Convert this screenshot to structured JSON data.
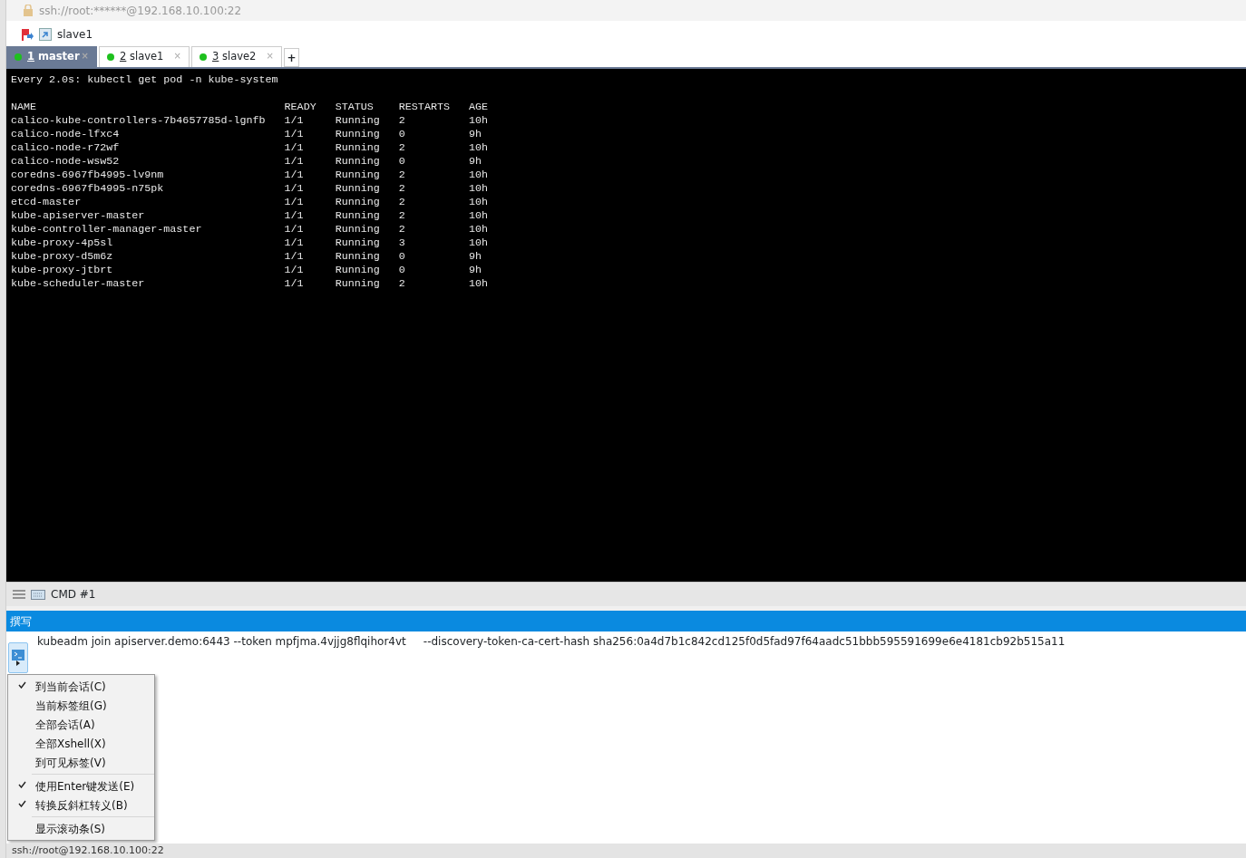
{
  "address_bar": {
    "text": "ssh://root:******@192.168.10.100:22"
  },
  "session_bar": {
    "title": "slave1"
  },
  "tabs": [
    {
      "number": "1",
      "name": "master",
      "selected": true,
      "connected": true,
      "close": "×"
    },
    {
      "number": "2",
      "name": "slave1",
      "selected": false,
      "connected": true,
      "close": "×"
    },
    {
      "number": "3",
      "name": "slave2",
      "selected": false,
      "connected": true,
      "close": "×"
    }
  ],
  "new_tab": "+",
  "terminal": {
    "header": "Every 2.0s: kubectl get pod -n kube-system",
    "columns": [
      "NAME",
      "READY",
      "STATUS",
      "RESTARTS",
      "AGE"
    ],
    "rows": [
      [
        "calico-kube-controllers-7b4657785d-lgnfb",
        "1/1",
        "Running",
        "2",
        "10h"
      ],
      [
        "calico-node-lfxc4",
        "1/1",
        "Running",
        "0",
        "9h"
      ],
      [
        "calico-node-r72wf",
        "1/1",
        "Running",
        "2",
        "10h"
      ],
      [
        "calico-node-wsw52",
        "1/1",
        "Running",
        "0",
        "9h"
      ],
      [
        "coredns-6967fb4995-lv9nm",
        "1/1",
        "Running",
        "2",
        "10h"
      ],
      [
        "coredns-6967fb4995-n75pk",
        "1/1",
        "Running",
        "2",
        "10h"
      ],
      [
        "etcd-master",
        "1/1",
        "Running",
        "2",
        "10h"
      ],
      [
        "kube-apiserver-master",
        "1/1",
        "Running",
        "2",
        "10h"
      ],
      [
        "kube-controller-manager-master",
        "1/1",
        "Running",
        "2",
        "10h"
      ],
      [
        "kube-proxy-4p5sl",
        "1/1",
        "Running",
        "3",
        "10h"
      ],
      [
        "kube-proxy-d5m6z",
        "1/1",
        "Running",
        "0",
        "9h"
      ],
      [
        "kube-proxy-jtbrt",
        "1/1",
        "Running",
        "0",
        "9h"
      ],
      [
        "kube-scheduler-master",
        "1/1",
        "Running",
        "2",
        "10h"
      ]
    ]
  },
  "cmd_bar": {
    "label": "CMD #1"
  },
  "compose": {
    "title": "撰写",
    "text": "kubeadm join apiserver.demo:6443 --token mpfjma.4vjjg8flqihor4vt     --discovery-token-ca-cert-hash sha256:0a4d7b1c842cd125f0d5fad97f64aadc51bbb595591699e6e4181cb92b515a11"
  },
  "menu": [
    [
      {
        "label": "到当前会话(C)",
        "checked": true
      },
      {
        "label": "当前标签组(G)",
        "checked": false
      },
      {
        "label": "全部会话(A)",
        "checked": false
      },
      {
        "label": "全部Xshell(X)",
        "checked": false
      },
      {
        "label": "到可见标签(V)",
        "checked": false
      }
    ],
    [
      {
        "label": "使用Enter键发送(E)",
        "checked": true
      },
      {
        "label": "转换反斜杠转义(B)",
        "checked": true
      }
    ],
    [
      {
        "label": "显示滚动条(S)",
        "checked": false
      }
    ]
  ],
  "status_bar": {
    "text": "ssh://root@192.168.10.100:22"
  }
}
